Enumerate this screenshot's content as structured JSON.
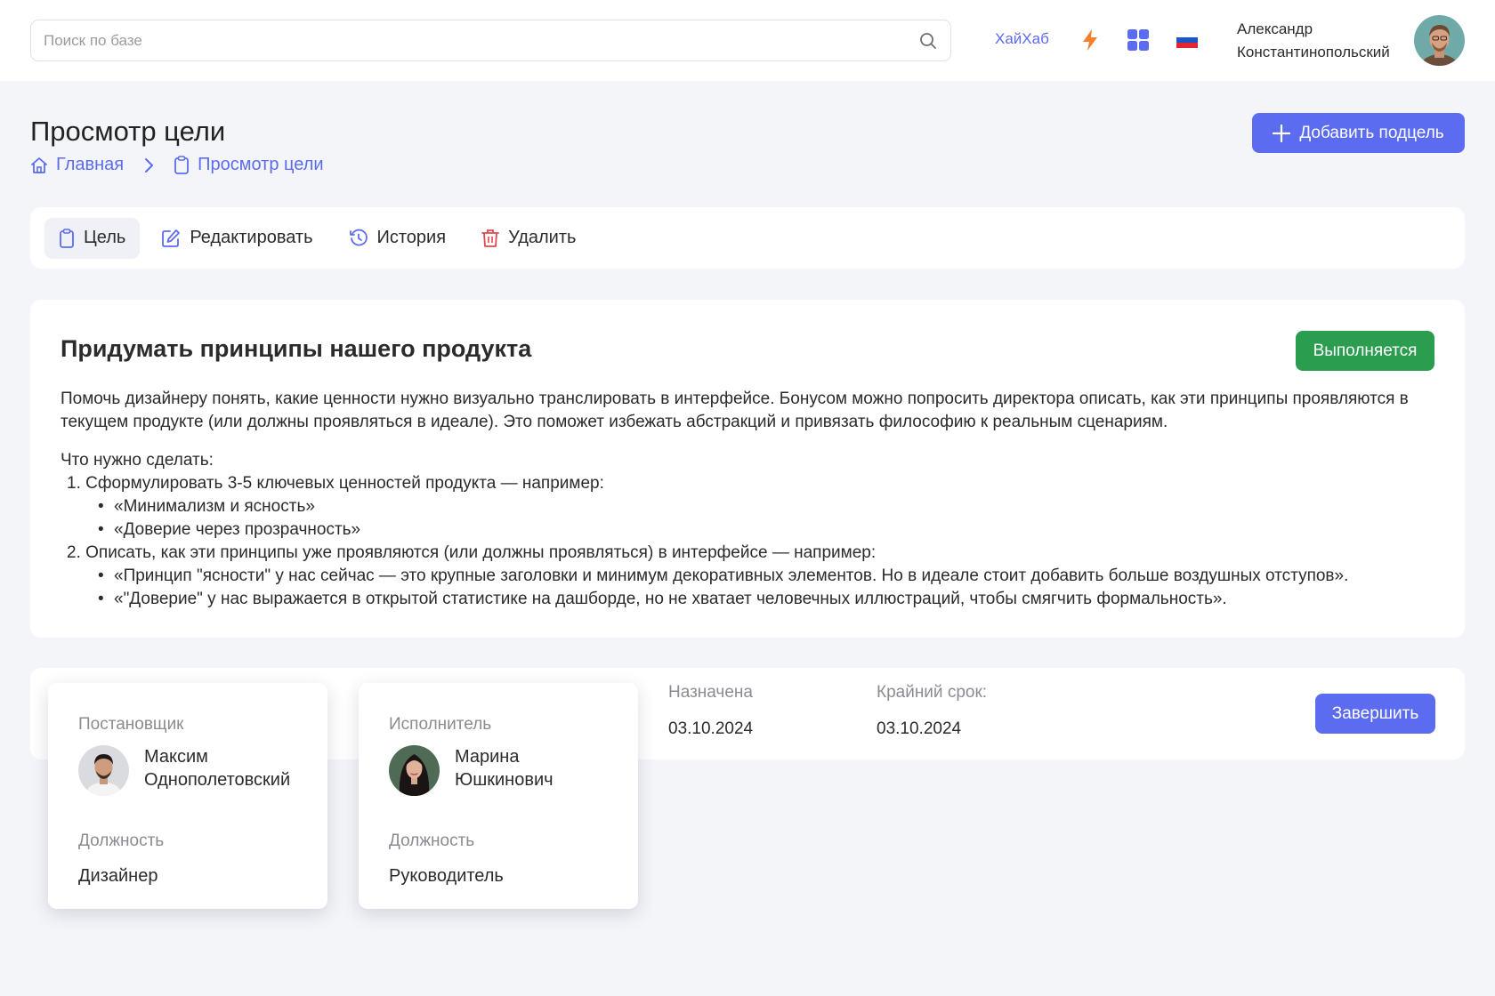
{
  "header": {
    "search_placeholder": "Поиск по базе",
    "hub_link": "ХайХаб",
    "user": {
      "first_name": "Александр",
      "last_name": "Константинопольский"
    },
    "icons": [
      "search-icon",
      "lightning-icon",
      "apps-grid-icon",
      "russia-flag-icon"
    ]
  },
  "page": {
    "title": "Просмотр цели",
    "breadcrumb": [
      {
        "label": "Главная",
        "icon": "home-icon"
      },
      {
        "label": "Просмотр цели",
        "icon": "clipboard-icon"
      }
    ],
    "add_button": "Добавить подцель"
  },
  "tabs": [
    {
      "label": "Цель",
      "icon": "clipboard-icon",
      "active": true
    },
    {
      "label": "Редактировать",
      "icon": "edit-icon",
      "active": false
    },
    {
      "label": "История",
      "icon": "history-icon",
      "active": false
    },
    {
      "label": "Удалить",
      "icon": "trash-icon",
      "active": false
    }
  ],
  "goal": {
    "title": "Придумать принципы нашего продукта",
    "status": "Выполняется",
    "description": "Помочь дизайнеру понять, какие ценности нужно визуально транслировать в интерфейсе. Бонусом можно попросить директора описать, как эти принципы проявляются в текущем продукте (или должны проявляться в идеале). Это поможет избежать абстракций и привязать философию к реальным сценариям.",
    "todo_heading": "Что нужно сделать:",
    "todo": [
      {
        "text": "1. Сформулировать 3-5 ключевых ценностей продукта — например:",
        "sub": [
          "«Минимализм и ясность»",
          "«Доверие через прозрачность»"
        ]
      },
      {
        "text": "2. Описать, как эти принципы уже проявляются (или должны проявляться) в интерфейсе — например:",
        "sub": [
          "«Принцип \"ясности\" у нас сейчас — это крупные заголовки и минимум декоративных элементов. Но в идеале стоит добавить больше воздушных отступов».",
          "«\"Доверие\" у нас выражается в открытой статистике на дашборде, но не хватает человечных иллюстраций, чтобы смягчить формальность»."
        ]
      }
    ]
  },
  "meta": {
    "assigned_label": "Назначена",
    "assigned_value": "03.10.2024",
    "deadline_label": "Крайний срок:",
    "deadline_value": "03.10.2024",
    "finish_button": "Завершить"
  },
  "people": {
    "creator": {
      "label": "Постановщик",
      "first_name": "Максим",
      "last_name": "Однополетовский",
      "role_label": "Должность",
      "role": "Дизайнер"
    },
    "executor": {
      "label": "Исполнитель",
      "first_name": "Марина",
      "last_name": "Юшкинович",
      "role_label": "Должность",
      "role": "Руководитель"
    }
  },
  "colors": {
    "accent": "#5b6cf0",
    "status_green": "#2a9d4f",
    "background": "#f4f5f9",
    "lightning": "#f5802a",
    "delete_red": "#e0484f"
  }
}
